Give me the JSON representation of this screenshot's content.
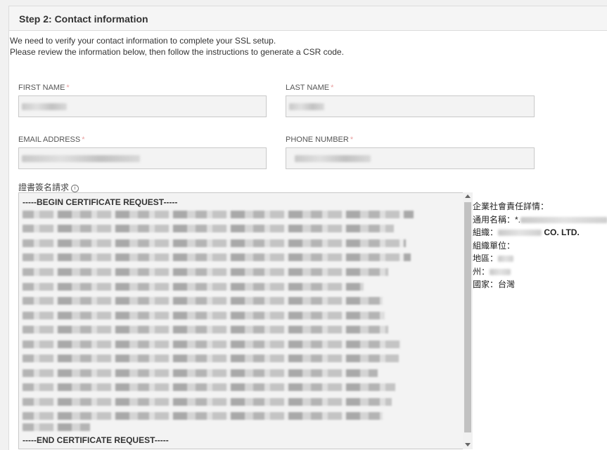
{
  "step_title": "Step 2: Contact information",
  "intro": {
    "line1": "We need to verify your contact information to complete your SSL setup.",
    "line2": "Please review the information below, then follow the instructions to generate a CSR code."
  },
  "form": {
    "first_name_label": "FIRST NAME",
    "last_name_label": "LAST NAME",
    "email_label": "EMAIL ADDRESS",
    "phone_label": "PHONE NUMBER",
    "required_mark": "*",
    "csr_label": "證書簽名請求",
    "csr_info_glyph": "i"
  },
  "csr": {
    "begin": "-----BEGIN CERTIFICATE REQUEST-----",
    "end": "-----END CERTIFICATE REQUEST-----"
  },
  "details": {
    "header": "企業社會責任詳情：",
    "common_name_label": "通用名稱：",
    "common_name_prefix": "*.",
    "org_label": "組織：",
    "org_suffix": "CO. LTD.",
    "unit_label": "組織單位：",
    "locality_label": "地區：",
    "state_label": "州：",
    "country_label": "國家：",
    "country_value": "台灣"
  },
  "colors": {
    "panel_header_bg": "#f5f5f5",
    "input_bg": "#f3f3f3",
    "required": "#e8a0a0"
  }
}
